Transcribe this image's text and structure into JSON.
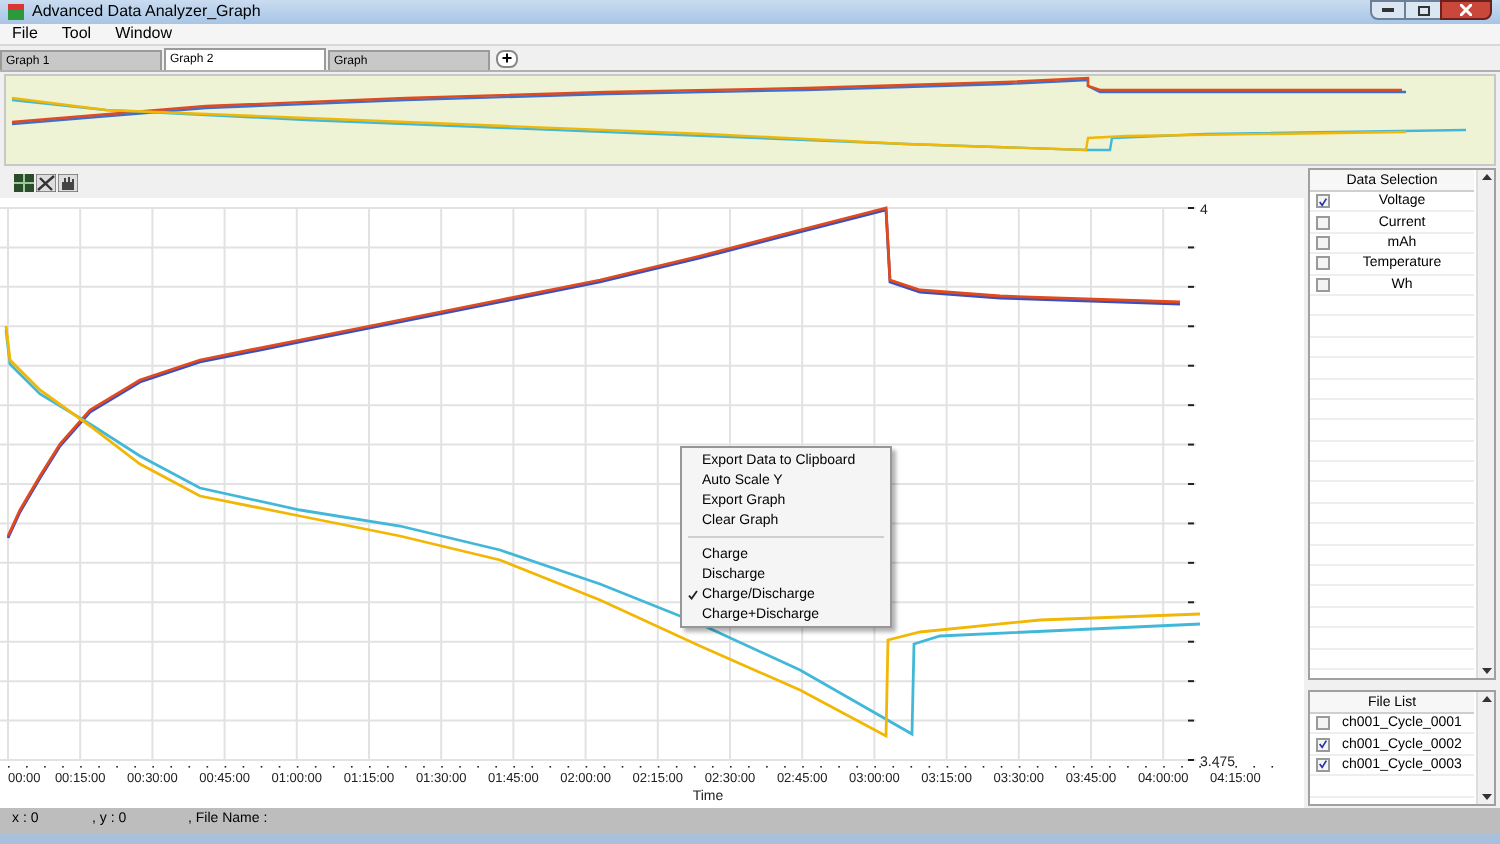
{
  "window": {
    "title": "Advanced Data Analyzer_Graph"
  },
  "menu": [
    "File",
    "Tool",
    "Window"
  ],
  "tabs": [
    {
      "label": "Graph 1",
      "selected": false
    },
    {
      "label": "Graph 2",
      "selected": true
    },
    {
      "label": "Graph",
      "selected": false
    }
  ],
  "add_tab_button": "+",
  "graph": {
    "y_top_label": "4",
    "y_bottom_label": "3.475",
    "xlabel": "Time",
    "x_labels": [
      "00:00",
      "00:15:00",
      "00:30:00",
      "00:45:00",
      "01:00:00",
      "01:15:00",
      "01:30:00",
      "01:45:00",
      "02:00:00",
      "02:15:00",
      "02:30:00",
      "02:45:00",
      "03:00:00",
      "03:15:00",
      "03:30:00",
      "03:45:00",
      "04:00:00",
      "04:15:00"
    ]
  },
  "context_menu": [
    {
      "label": "Export Data to Clipboard",
      "checked": false
    },
    {
      "label": "Auto Scale Y",
      "checked": false
    },
    {
      "label": "Export Graph",
      "checked": false
    },
    {
      "label": "Clear Graph",
      "checked": false
    },
    {
      "label": "Charge",
      "checked": false,
      "separator_before": true
    },
    {
      "label": "Discharge",
      "checked": false
    },
    {
      "label": "Charge/Discharge",
      "checked": true
    },
    {
      "label": "Charge+Discharge",
      "checked": false
    }
  ],
  "data_selection": {
    "title": "Data Selection",
    "items": [
      {
        "label": "Voltage",
        "checked": true
      },
      {
        "label": "Current",
        "checked": false
      },
      {
        "label": "mAh",
        "checked": false
      },
      {
        "label": "Temperature",
        "checked": false
      },
      {
        "label": "Wh",
        "checked": false
      }
    ]
  },
  "file_list": {
    "title": "File List",
    "items": [
      {
        "label": "ch001_Cycle_0001",
        "checked": false
      },
      {
        "label": "ch001_Cycle_0002",
        "checked": true
      },
      {
        "label": "ch001_Cycle_0003",
        "checked": true
      }
    ]
  },
  "status_bar": [
    "x : 0",
    ", y : 0",
    ", File Name :"
  ]
}
